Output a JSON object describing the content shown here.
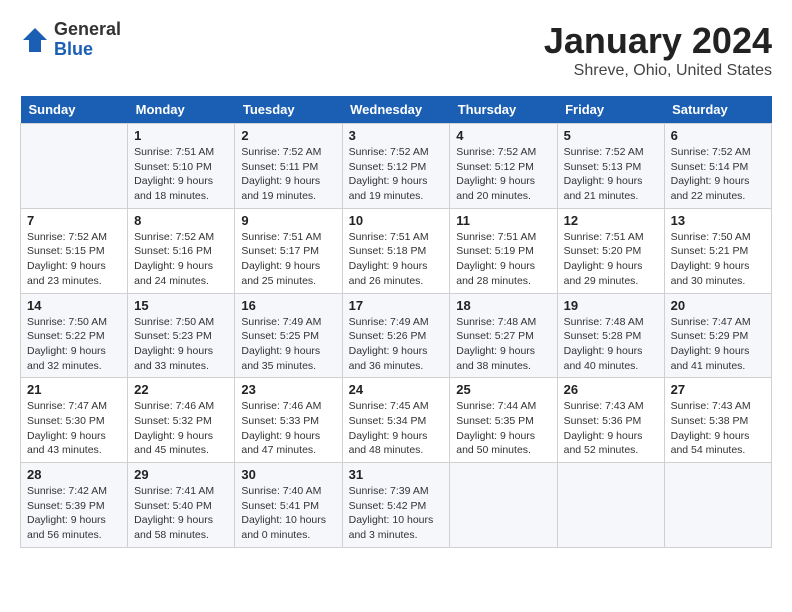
{
  "header": {
    "logo_general": "General",
    "logo_blue": "Blue",
    "month_title": "January 2024",
    "location": "Shreve, Ohio, United States"
  },
  "weekdays": [
    "Sunday",
    "Monday",
    "Tuesday",
    "Wednesday",
    "Thursday",
    "Friday",
    "Saturday"
  ],
  "weeks": [
    [
      {
        "day": "",
        "info": ""
      },
      {
        "day": "1",
        "info": "Sunrise: 7:51 AM\nSunset: 5:10 PM\nDaylight: 9 hours\nand 18 minutes."
      },
      {
        "day": "2",
        "info": "Sunrise: 7:52 AM\nSunset: 5:11 PM\nDaylight: 9 hours\nand 19 minutes."
      },
      {
        "day": "3",
        "info": "Sunrise: 7:52 AM\nSunset: 5:12 PM\nDaylight: 9 hours\nand 19 minutes."
      },
      {
        "day": "4",
        "info": "Sunrise: 7:52 AM\nSunset: 5:12 PM\nDaylight: 9 hours\nand 20 minutes."
      },
      {
        "day": "5",
        "info": "Sunrise: 7:52 AM\nSunset: 5:13 PM\nDaylight: 9 hours\nand 21 minutes."
      },
      {
        "day": "6",
        "info": "Sunrise: 7:52 AM\nSunset: 5:14 PM\nDaylight: 9 hours\nand 22 minutes."
      }
    ],
    [
      {
        "day": "7",
        "info": "Sunrise: 7:52 AM\nSunset: 5:15 PM\nDaylight: 9 hours\nand 23 minutes."
      },
      {
        "day": "8",
        "info": "Sunrise: 7:52 AM\nSunset: 5:16 PM\nDaylight: 9 hours\nand 24 minutes."
      },
      {
        "day": "9",
        "info": "Sunrise: 7:51 AM\nSunset: 5:17 PM\nDaylight: 9 hours\nand 25 minutes."
      },
      {
        "day": "10",
        "info": "Sunrise: 7:51 AM\nSunset: 5:18 PM\nDaylight: 9 hours\nand 26 minutes."
      },
      {
        "day": "11",
        "info": "Sunrise: 7:51 AM\nSunset: 5:19 PM\nDaylight: 9 hours\nand 28 minutes."
      },
      {
        "day": "12",
        "info": "Sunrise: 7:51 AM\nSunset: 5:20 PM\nDaylight: 9 hours\nand 29 minutes."
      },
      {
        "day": "13",
        "info": "Sunrise: 7:50 AM\nSunset: 5:21 PM\nDaylight: 9 hours\nand 30 minutes."
      }
    ],
    [
      {
        "day": "14",
        "info": "Sunrise: 7:50 AM\nSunset: 5:22 PM\nDaylight: 9 hours\nand 32 minutes."
      },
      {
        "day": "15",
        "info": "Sunrise: 7:50 AM\nSunset: 5:23 PM\nDaylight: 9 hours\nand 33 minutes."
      },
      {
        "day": "16",
        "info": "Sunrise: 7:49 AM\nSunset: 5:25 PM\nDaylight: 9 hours\nand 35 minutes."
      },
      {
        "day": "17",
        "info": "Sunrise: 7:49 AM\nSunset: 5:26 PM\nDaylight: 9 hours\nand 36 minutes."
      },
      {
        "day": "18",
        "info": "Sunrise: 7:48 AM\nSunset: 5:27 PM\nDaylight: 9 hours\nand 38 minutes."
      },
      {
        "day": "19",
        "info": "Sunrise: 7:48 AM\nSunset: 5:28 PM\nDaylight: 9 hours\nand 40 minutes."
      },
      {
        "day": "20",
        "info": "Sunrise: 7:47 AM\nSunset: 5:29 PM\nDaylight: 9 hours\nand 41 minutes."
      }
    ],
    [
      {
        "day": "21",
        "info": "Sunrise: 7:47 AM\nSunset: 5:30 PM\nDaylight: 9 hours\nand 43 minutes."
      },
      {
        "day": "22",
        "info": "Sunrise: 7:46 AM\nSunset: 5:32 PM\nDaylight: 9 hours\nand 45 minutes."
      },
      {
        "day": "23",
        "info": "Sunrise: 7:46 AM\nSunset: 5:33 PM\nDaylight: 9 hours\nand 47 minutes."
      },
      {
        "day": "24",
        "info": "Sunrise: 7:45 AM\nSunset: 5:34 PM\nDaylight: 9 hours\nand 48 minutes."
      },
      {
        "day": "25",
        "info": "Sunrise: 7:44 AM\nSunset: 5:35 PM\nDaylight: 9 hours\nand 50 minutes."
      },
      {
        "day": "26",
        "info": "Sunrise: 7:43 AM\nSunset: 5:36 PM\nDaylight: 9 hours\nand 52 minutes."
      },
      {
        "day": "27",
        "info": "Sunrise: 7:43 AM\nSunset: 5:38 PM\nDaylight: 9 hours\nand 54 minutes."
      }
    ],
    [
      {
        "day": "28",
        "info": "Sunrise: 7:42 AM\nSunset: 5:39 PM\nDaylight: 9 hours\nand 56 minutes."
      },
      {
        "day": "29",
        "info": "Sunrise: 7:41 AM\nSunset: 5:40 PM\nDaylight: 9 hours\nand 58 minutes."
      },
      {
        "day": "30",
        "info": "Sunrise: 7:40 AM\nSunset: 5:41 PM\nDaylight: 10 hours\nand 0 minutes."
      },
      {
        "day": "31",
        "info": "Sunrise: 7:39 AM\nSunset: 5:42 PM\nDaylight: 10 hours\nand 3 minutes."
      },
      {
        "day": "",
        "info": ""
      },
      {
        "day": "",
        "info": ""
      },
      {
        "day": "",
        "info": ""
      }
    ]
  ]
}
